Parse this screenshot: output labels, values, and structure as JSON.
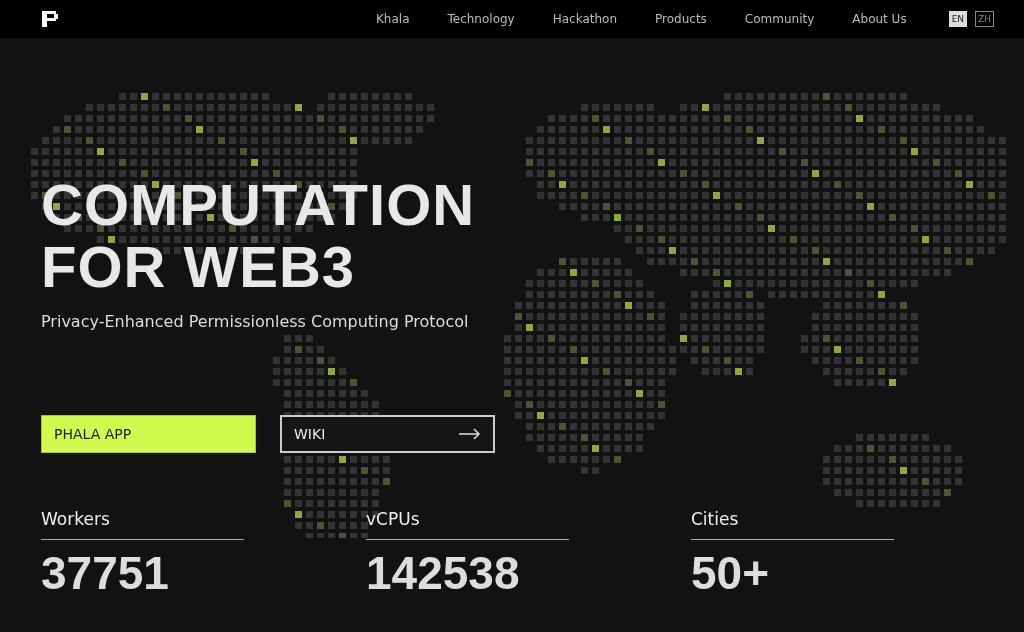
{
  "nav": {
    "links": [
      "Khala",
      "Technology",
      "Hackathon",
      "Products",
      "Community",
      "About Us"
    ],
    "languages": [
      {
        "label": "EN",
        "selected": true
      },
      {
        "label": "ZH",
        "selected": false
      }
    ]
  },
  "hero": {
    "title_lines": [
      "COMPUTATION",
      "FOR WEB3"
    ],
    "subtitle": "Privacy-Enhanced Permissionless Computing Protocol",
    "buttons": [
      {
        "label": "PHALA APP",
        "kind": "primary"
      },
      {
        "label": "WIKI",
        "kind": "outline"
      }
    ]
  },
  "stats": [
    {
      "label": "Workers",
      "value": "37751"
    },
    {
      "label": "vCPUs",
      "value": "142538"
    },
    {
      "label": "Cities",
      "value": "50+"
    }
  ]
}
